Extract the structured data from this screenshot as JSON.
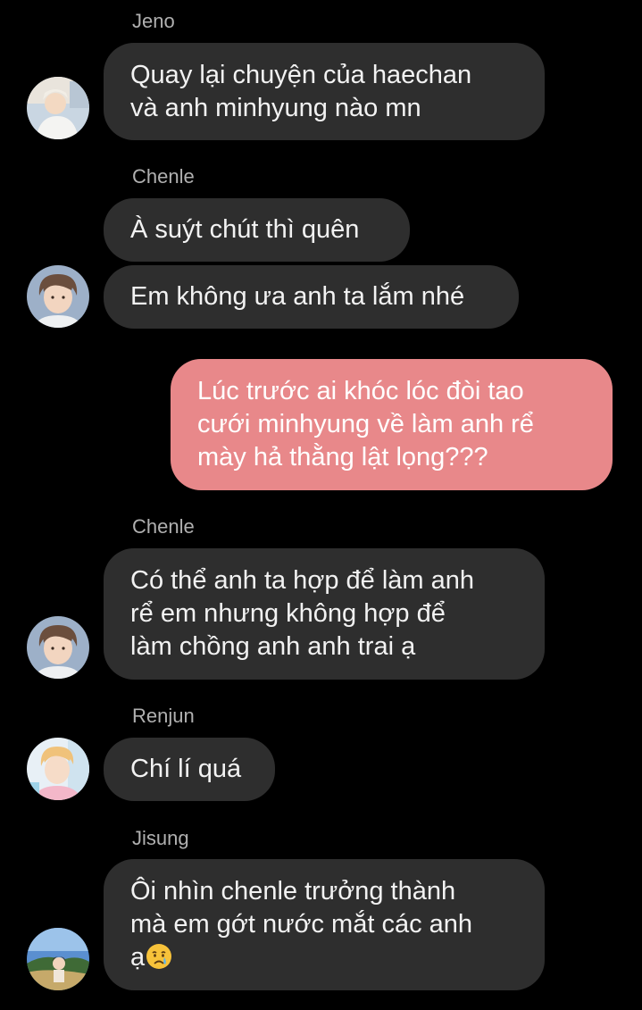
{
  "chat": {
    "messages": [
      {
        "sender": "Jeno",
        "lines": [
          "Quay lại chuyện của haechan",
          "và anh minhyung nào mn"
        ]
      },
      {
        "sender": "Chenle",
        "lines": [
          "À suýt chút thì quên"
        ]
      },
      {
        "lines": [
          "Em không ưa anh ta lắm nhé"
        ]
      },
      {
        "lines": [
          "Lúc trước ai khóc lóc đòi tao",
          "cưới minhyung về làm anh rể",
          "mày hả thằng lật lọng???"
        ]
      },
      {
        "sender": "Chenle",
        "lines": [
          "Có thể anh ta hợp để làm anh",
          "rể em nhưng không hợp để",
          "làm chồng anh anh trai ạ"
        ]
      },
      {
        "sender": "Renjun",
        "lines": [
          "Chí lí quá"
        ]
      },
      {
        "sender": "Jisung",
        "lines": [
          "Ôi nhìn chenle trưởng thành",
          "mà em gớt nước mắt các anh",
          "ạ"
        ]
      }
    ]
  },
  "colors": {
    "background": "#000000",
    "incoming_bubble": "#2e2e2e",
    "outgoing_bubble": "#e8888a",
    "sender_name": "#b0b0b0"
  },
  "icons": {
    "last_message_emoji": "crying-face-emoji-icon"
  }
}
